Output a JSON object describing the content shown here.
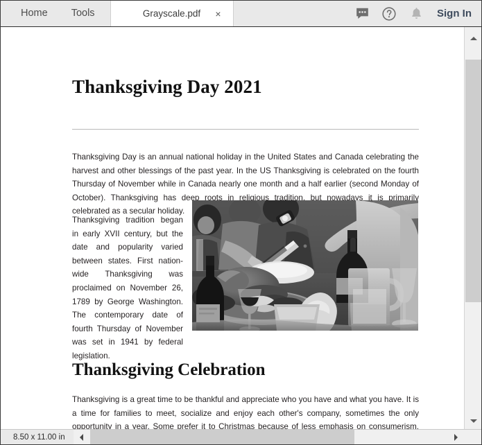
{
  "window": {
    "page_size_label": "8.50 x 11.00 in"
  },
  "toolbar": {
    "menu_items": [
      {
        "label": "Home",
        "name": "home"
      },
      {
        "label": "Tools",
        "name": "tools"
      }
    ],
    "tab": {
      "label": "Grayscale.pdf",
      "close_label": "×"
    },
    "icons": [
      {
        "name": "comment-icon",
        "title": "Comment"
      },
      {
        "name": "help-icon",
        "title": "Help"
      },
      {
        "name": "notification-bell-icon",
        "title": "Notifications"
      }
    ],
    "sign_in_label": "Sign In"
  },
  "document": {
    "title": "Thanksgiving Day 2021",
    "paragraph_1": "Thanksgiving Day is an annual national holiday in the United States and Canada celebrating the harvest and other blessings of the past year. In the US Thanksgiving is celebrated on the fourth Thursday of November while in Canada nearly one month and a half earlier (second Monday of October). Thanksgiving has deep roots in religious tradition, but nowadays it is primarily celebrated as a secular holiday.",
    "paragraph_2": "Thanksgiving tradition began in early XVII century, but the date and popularity varied between states. First nation-wide Thanksgiving was proclaimed on November 26, 1789 by George Washington. The contemporary date of fourth Thursday of November was set in 1941 by federal legislation.",
    "subtitle": "Thanksgiving Celebration",
    "paragraph_3": "Thanksgiving is a great time to be thankful and appreciate who you have and what you have. It is a time for families to meet, socialize and enjoy each other's company, sometimes the only opportunity in a year. Some prefer it to Christmas because of less emphasis on consumerism. Thanksgiving, for most, is also a start of a four-day weekend which is great, too.",
    "photo": {
      "name": "thanksgiving-dinner-photo",
      "description": "Grayscale photograph of people at a Thanksgiving dinner table carving a turkey, with wine bottles, wine glasses and a water pitcher"
    }
  },
  "colors": {
    "toolbar_bg": "#e9e9e9",
    "tab_active_bg": "#ffffff",
    "signin_text": "#3d4a5c",
    "body_text": "#231f20",
    "scrollbar_thumb": "#cdcdcd",
    "rule": "#b9b9b9"
  }
}
